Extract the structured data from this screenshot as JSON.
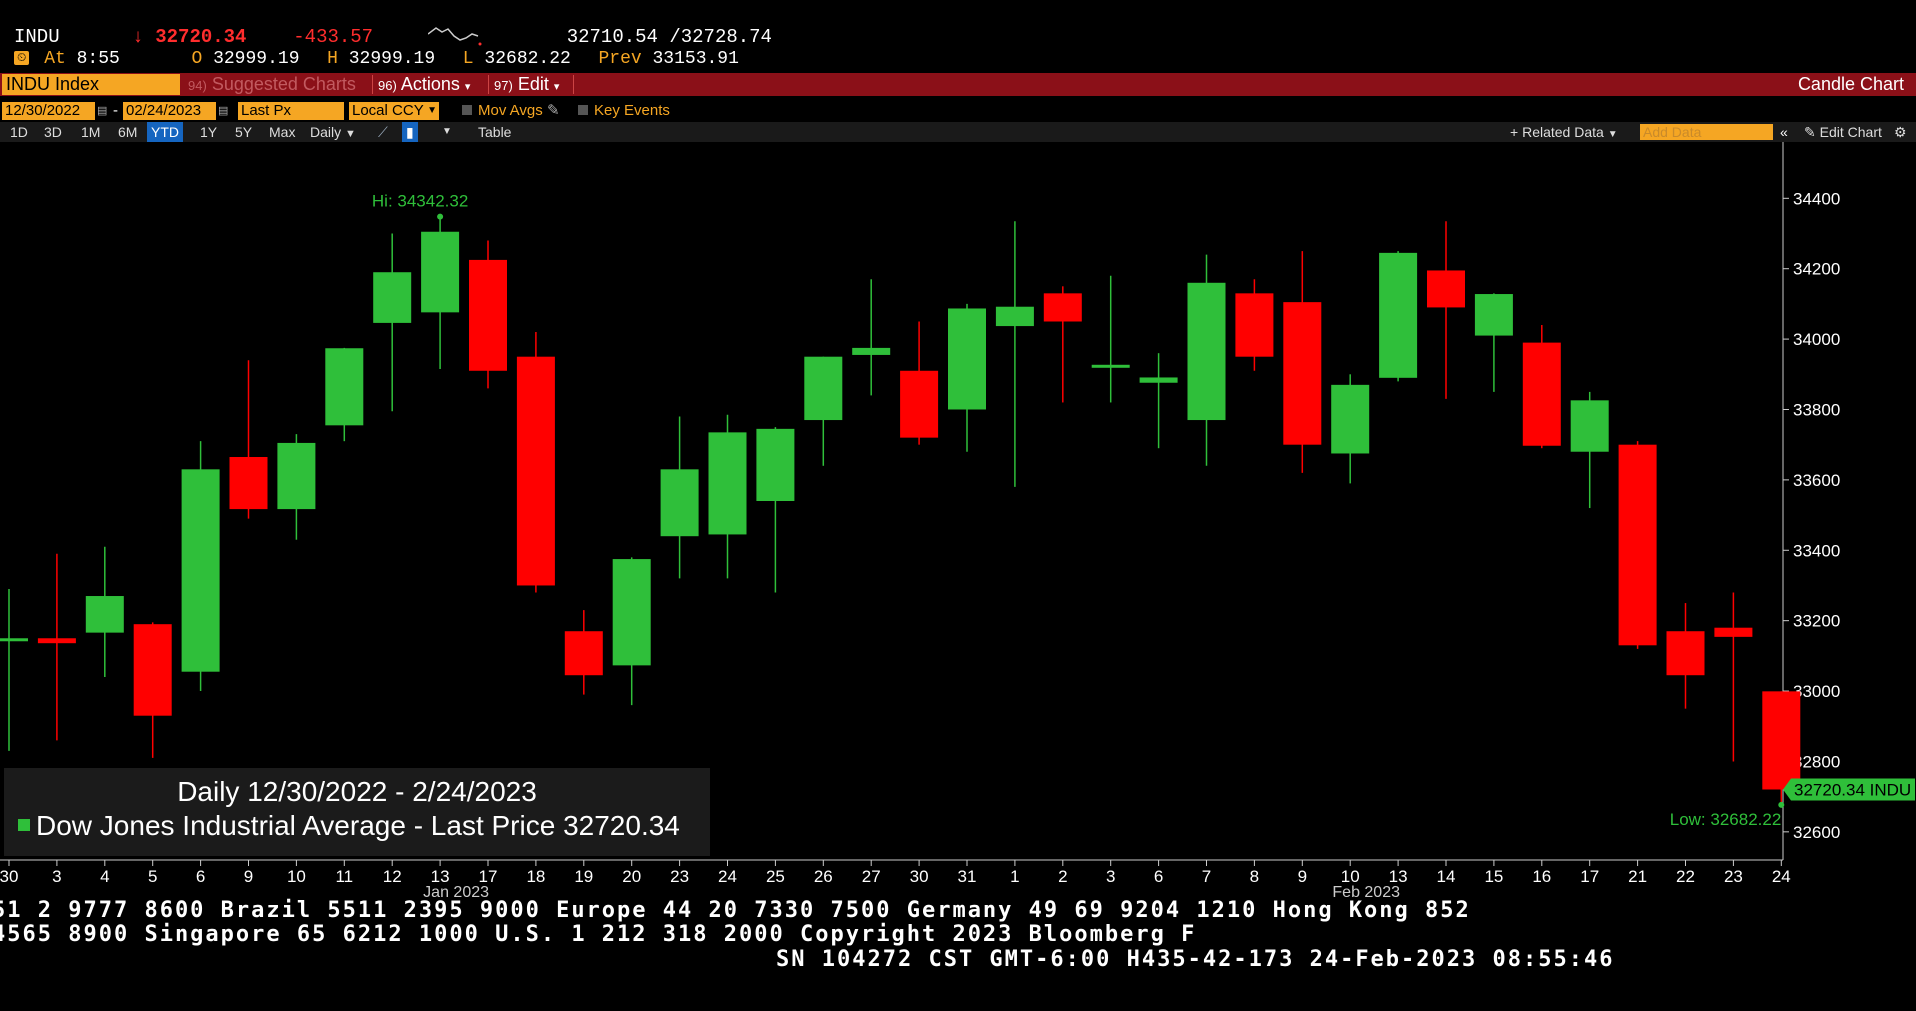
{
  "quote": {
    "ticker": "INDU",
    "arrow": "↓",
    "last": "32720.34",
    "change": "-433.57",
    "bid_ask": "32710.54 /32728.74",
    "clock_icon": "clock-icon",
    "at_label": "At",
    "time": "8:55",
    "open_label": "O",
    "open": "32999.19",
    "high_label": "H",
    "high": "32999.19",
    "low_label": "L",
    "low": "32682.22",
    "prev_label": "Prev",
    "prev": "33153.91"
  },
  "function_bar": {
    "security": "INDU Index",
    "suggested_num": "94)",
    "suggested": "Suggested Charts",
    "actions_num": "96)",
    "actions": "Actions",
    "edit_num": "97)",
    "edit": "Edit",
    "chart_type": "Candle Chart"
  },
  "options_row": {
    "start_date": "12/30/2022",
    "dash": "-",
    "end_date": "02/24/2023",
    "field": "Last Px",
    "currency": "Local CCY",
    "mov_avgs": "Mov Avgs",
    "key_events": "Key Events"
  },
  "range_row": {
    "buttons": [
      "1D",
      "3D",
      "1M",
      "6M",
      "YTD",
      "1Y",
      "5Y",
      "Max"
    ],
    "active": "YTD",
    "frequency": "Daily",
    "table": "Table",
    "related_data": "Related Data",
    "add_data_placeholder": "Add Data",
    "edit_chart": "Edit Chart"
  },
  "legend": {
    "line1": "Daily 12/30/2022 - 2/24/2023",
    "line2": "Dow Jones Industrial Average - Last Price 32720.34"
  },
  "footer": {
    "line1": "51 2 9777 8600 Brazil 5511 2395 9000 Europe 44 20 7330 7500 Germany 49 69 9204 1210 Hong Kong 852",
    "line2": " 4565 8900       Singapore 65 6212 1000        U.S. 1 212 318 2000          Copyright 2023 Bloomberg F",
    "line3": "SN 104272 CST  GMT-6:00 H435-42-173 24-Feb-2023 08:55:46"
  },
  "colors": {
    "up": "#2fbf3a",
    "down": "#ff0000",
    "accent": "#f5a623",
    "bar": "#8b1018"
  },
  "chart_data": {
    "type": "candlestick",
    "ylim": [
      32520,
      34560
    ],
    "yticks": [
      32600,
      32800,
      33000,
      33200,
      33400,
      33600,
      33800,
      34000,
      34200,
      34400
    ],
    "hi_label": "Hi: 34342.32",
    "low_label": "Low: 32682.22",
    "last_label": "32720.34 INDU",
    "last_value": 32720.34,
    "month_labels": [
      {
        "text": "Jan 2023",
        "at_index": 9
      },
      {
        "text": "Feb 2023",
        "at_index": 28
      }
    ],
    "candles": [
      {
        "d": "30",
        "o": 33150,
        "h": 33290,
        "l": 32830,
        "c": 33150
      },
      {
        "d": "3",
        "o": 33150,
        "h": 33390,
        "l": 32860,
        "c": 33136
      },
      {
        "d": "4",
        "o": 33166,
        "h": 33410,
        "l": 33040,
        "c": 33270
      },
      {
        "d": "5",
        "o": 33190,
        "h": 33195,
        "l": 32810,
        "c": 32930
      },
      {
        "d": "6",
        "o": 33055,
        "h": 33710,
        "l": 33000,
        "c": 33630
      },
      {
        "d": "9",
        "o": 33665,
        "h": 33940,
        "l": 33490,
        "c": 33517
      },
      {
        "d": "10",
        "o": 33517,
        "h": 33730,
        "l": 33430,
        "c": 33705
      },
      {
        "d": "11",
        "o": 33755,
        "h": 33975,
        "l": 33710,
        "c": 33974
      },
      {
        "d": "12",
        "o": 34046,
        "h": 34300,
        "l": 33795,
        "c": 34190
      },
      {
        "d": "13",
        "o": 34076,
        "h": 34342.32,
        "l": 33915,
        "c": 34305
      },
      {
        "d": "17",
        "o": 34225,
        "h": 34280,
        "l": 33860,
        "c": 33910
      },
      {
        "d": "18",
        "o": 33950,
        "h": 34020,
        "l": 33280,
        "c": 33300
      },
      {
        "d": "19",
        "o": 33170,
        "h": 33230,
        "l": 32990,
        "c": 33045
      },
      {
        "d": "20",
        "o": 33073,
        "h": 33380,
        "l": 32960,
        "c": 33375
      },
      {
        "d": "23",
        "o": 33440,
        "h": 33780,
        "l": 33320,
        "c": 33630
      },
      {
        "d": "24",
        "o": 33445,
        "h": 33785,
        "l": 33320,
        "c": 33735
      },
      {
        "d": "25",
        "o": 33540,
        "h": 33750,
        "l": 33280,
        "c": 33745
      },
      {
        "d": "26",
        "o": 33770,
        "h": 33950,
        "l": 33640,
        "c": 33950
      },
      {
        "d": "27",
        "o": 33955,
        "h": 34170,
        "l": 33840,
        "c": 33975
      },
      {
        "d": "30",
        "o": 33910,
        "h": 34050,
        "l": 33700,
        "c": 33720
      },
      {
        "d": "31",
        "o": 33800,
        "h": 34100,
        "l": 33680,
        "c": 34087
      },
      {
        "d": "1",
        "o": 34037,
        "h": 34335,
        "l": 33580,
        "c": 34092
      },
      {
        "d": "2",
        "o": 34130,
        "h": 34150,
        "l": 33820,
        "c": 34050
      },
      {
        "d": "3",
        "o": 33927,
        "h": 34180,
        "l": 33820,
        "c": 33927
      },
      {
        "d": "6",
        "o": 33876,
        "h": 33960,
        "l": 33690,
        "c": 33891
      },
      {
        "d": "7",
        "o": 33770,
        "h": 34240,
        "l": 33640,
        "c": 34160
      },
      {
        "d": "8",
        "o": 34130,
        "h": 34170,
        "l": 33910,
        "c": 33950
      },
      {
        "d": "9",
        "o": 34105,
        "h": 34250,
        "l": 33620,
        "c": 33700
      },
      {
        "d": "10",
        "o": 33675,
        "h": 33900,
        "l": 33590,
        "c": 33870
      },
      {
        "d": "13",
        "o": 33890,
        "h": 34250,
        "l": 33880,
        "c": 34245
      },
      {
        "d": "14",
        "o": 34195,
        "h": 34335,
        "l": 33830,
        "c": 34090
      },
      {
        "d": "15",
        "o": 34010,
        "h": 34130,
        "l": 33850,
        "c": 34128
      },
      {
        "d": "16",
        "o": 33990,
        "h": 34040,
        "l": 33690,
        "c": 33697
      },
      {
        "d": "17",
        "o": 33680,
        "h": 33850,
        "l": 33520,
        "c": 33826
      },
      {
        "d": "21",
        "o": 33700,
        "h": 33710,
        "l": 33120,
        "c": 33130
      },
      {
        "d": "22",
        "o": 33170,
        "h": 33250,
        "l": 32950,
        "c": 33045
      },
      {
        "d": "23",
        "o": 33180,
        "h": 33280,
        "l": 32800,
        "c": 33154
      },
      {
        "d": "24",
        "o": 32999.19,
        "h": 32999.19,
        "l": 32682.22,
        "c": 32720.34
      }
    ]
  }
}
